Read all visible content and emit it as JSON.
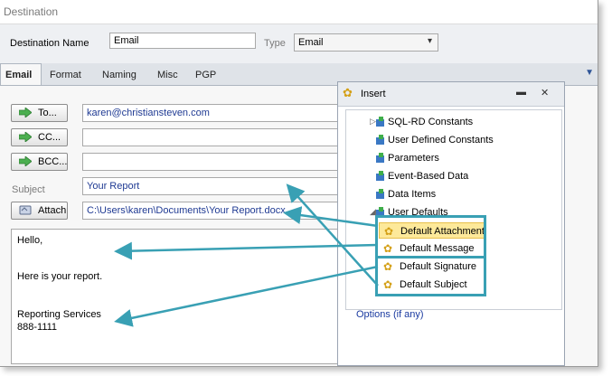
{
  "title": "Destination",
  "header": {
    "destination_name_label": "Destination Name",
    "destination_name_value": "Email",
    "type_label": "Type",
    "type_value": "Email"
  },
  "tabs": [
    "Email",
    "Format",
    "Naming",
    "Misc",
    "PGP"
  ],
  "email": {
    "to_label": "To...",
    "to_value": "karen@christiansteven.com",
    "cc_label": "CC...",
    "cc_value": "",
    "bcc_label": "BCC...",
    "bcc_value": "",
    "subject_label": "Subject",
    "subject_value": "Your Report",
    "attach_label": "Attach",
    "attach_value": "C:\\Users\\karen\\Documents\\Your Report.docx",
    "body_lines": [
      "Hello,",
      "Here is your report.",
      "Reporting Services",
      "888-1111"
    ]
  },
  "insert_panel": {
    "title": "Insert",
    "tree": [
      "SQL-RD Constants",
      "User Defined Constants",
      "Parameters",
      "Event-Based Data",
      "Data Items",
      "User Defaults"
    ],
    "defaults": [
      "Default Attachment",
      "Default Message",
      "Default Signature",
      "Default Subject"
    ],
    "options_label": "Options (if any)"
  },
  "colors": {
    "accent": "#39a0b4",
    "highlight": "#fde99a",
    "link_blue": "#1f3a93"
  }
}
